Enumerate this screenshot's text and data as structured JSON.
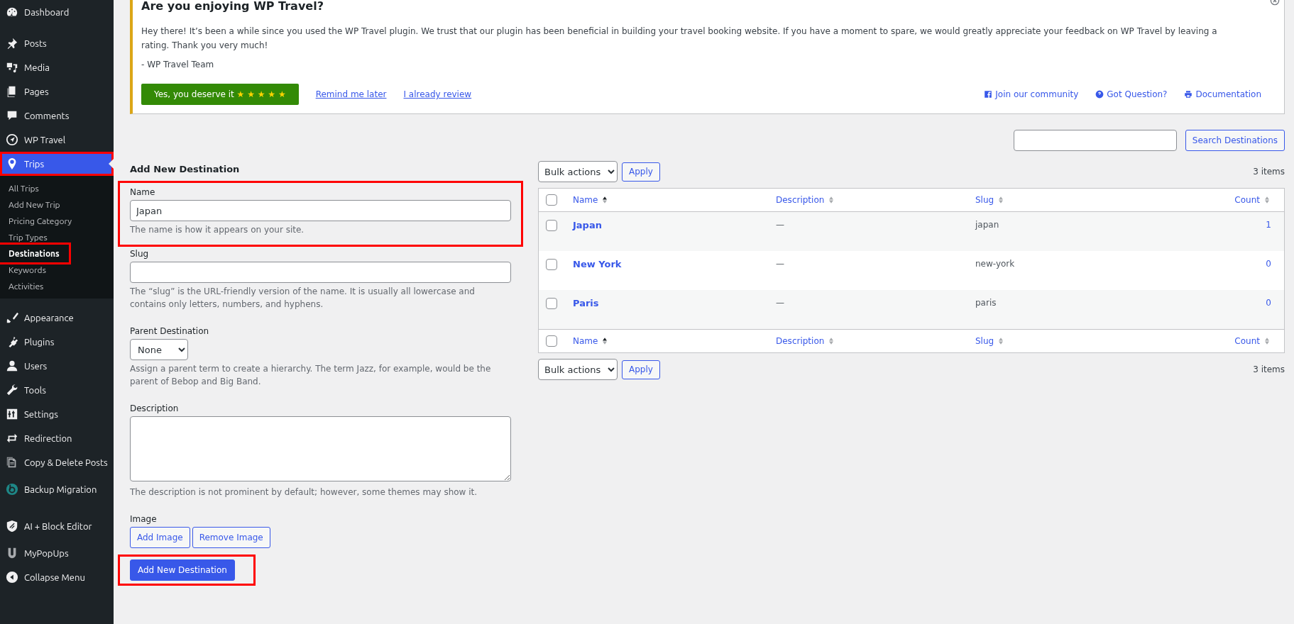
{
  "sidebar": {
    "items": [
      {
        "label": "Dashboard",
        "selected": false,
        "highlighted": false
      },
      {
        "label": "Posts",
        "selected": false,
        "highlighted": false
      },
      {
        "label": "Media",
        "selected": false,
        "highlighted": false
      },
      {
        "label": "Pages",
        "selected": false,
        "highlighted": false
      },
      {
        "label": "Comments",
        "selected": false,
        "highlighted": false
      },
      {
        "label": "WP Travel",
        "selected": false,
        "highlighted": false
      },
      {
        "label": "Trips",
        "selected": true,
        "highlighted": true,
        "children": [
          {
            "label": "All Trips",
            "selected": false,
            "highlighted": false
          },
          {
            "label": "Add New Trip",
            "selected": false,
            "highlighted": false
          },
          {
            "label": "Pricing Category",
            "selected": false,
            "highlighted": false
          },
          {
            "label": "Trip Types",
            "selected": false,
            "highlighted": false
          },
          {
            "label": "Destinations",
            "selected": true,
            "highlighted": true
          },
          {
            "label": "Keywords",
            "selected": false,
            "highlighted": false
          },
          {
            "label": "Activities",
            "selected": false,
            "highlighted": false
          }
        ]
      },
      {
        "label": "Appearance",
        "selected": false,
        "highlighted": false
      },
      {
        "label": "Plugins",
        "selected": false,
        "highlighted": false
      },
      {
        "label": "Users",
        "selected": false,
        "highlighted": false
      },
      {
        "label": "Tools",
        "selected": false,
        "highlighted": false
      },
      {
        "label": "Settings",
        "selected": false,
        "highlighted": false
      },
      {
        "label": "Redirection",
        "selected": false,
        "highlighted": false
      },
      {
        "label": "Copy & Delete Posts",
        "selected": false,
        "highlighted": false
      },
      {
        "label": "Backup Migration",
        "selected": false,
        "highlighted": false
      },
      {
        "label": "AI + Block Editor",
        "selected": false,
        "highlighted": false
      },
      {
        "label": "MyPopUps",
        "selected": false,
        "highlighted": false
      },
      {
        "label": "Collapse Menu",
        "selected": false,
        "highlighted": false
      }
    ]
  },
  "notice": {
    "title": "Are you enjoying WP Travel?",
    "message": "Hey there! It’s been a while since you used the WP Travel plugin. We trust that our plugin has been beneficial in building your travel booking website. If you have a moment to spare, we would greatly appreciate your feedback on WP Travel by leaving a rating. Thank you very much!",
    "signature": "- WP Travel Team",
    "rate_button": {
      "label": "Yes, you deserve it",
      "stars_text": "★ ★ ★ ★ ★"
    },
    "links": [
      "Remind me later",
      "I already review"
    ],
    "help_links": [
      "Join our community",
      "Got Question?",
      "Documentation"
    ]
  },
  "search": {
    "button": "Search Destinations"
  },
  "form": {
    "title": "Add New Destination",
    "name": {
      "label": "Name",
      "value": "Japan",
      "hint": "The name is how it appears on your site.",
      "highlighted": true
    },
    "slug": {
      "label": "Slug",
      "hint": "The “slug” is the URL-friendly version of the name. It is usually all lowercase and contains only letters, numbers, and hyphens."
    },
    "parent": {
      "label": "Parent Destination",
      "value": "None",
      "hint": "Assign a parent term to create a hierarchy. The term Jazz, for example, would be the parent of Bebop and Big Band."
    },
    "description": {
      "label": "Description",
      "hint": "The description is not prominent by default; however, some themes may show it."
    },
    "image": {
      "label": "Image",
      "buttons": [
        "Add Image",
        "Remove Image"
      ]
    },
    "submit": {
      "label": "Add New Destination",
      "highlighted": true
    }
  },
  "table": {
    "top_nav": {
      "bulk_action": "Bulk actions",
      "apply": "Apply",
      "count": "3 items"
    },
    "header_columns": [
      {
        "label": "Name",
        "sorted": true
      },
      {
        "label": "Description",
        "sorted": false
      },
      {
        "label": "Slug",
        "sorted": false
      },
      {
        "label": "Count",
        "sorted": false
      }
    ],
    "header_checked": false,
    "rows": [
      {
        "name": "Japan",
        "description": "—",
        "slug": "japan",
        "count": "1",
        "checked": false
      },
      {
        "name": "New York",
        "description": "—",
        "slug": "new-york",
        "count": "0",
        "checked": false
      },
      {
        "name": "Paris",
        "description": "—",
        "slug": "paris",
        "count": "0",
        "checked": false
      }
    ],
    "footer_columns": [
      {
        "label": "Name",
        "sorted": true
      },
      {
        "label": "Description",
        "sorted": false
      },
      {
        "label": "Slug",
        "sorted": false
      },
      {
        "label": "Count",
        "sorted": false
      }
    ],
    "footer_checked": false,
    "bottom_nav": {
      "bulk_action": "Bulk actions",
      "apply": "Apply",
      "count": "3 items"
    }
  }
}
